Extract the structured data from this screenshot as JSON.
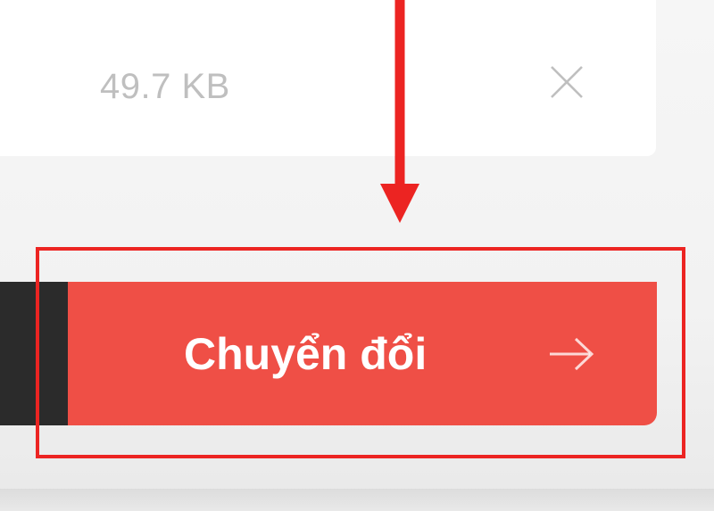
{
  "file": {
    "size_label": "49.7 KB"
  },
  "buttons": {
    "convert_label": "Chuyển đổi"
  },
  "icons": {
    "close": "close-icon",
    "arrow_right": "arrow-right-icon"
  },
  "colors": {
    "accent": "#ef4f46",
    "annotation": "#ec2422"
  }
}
